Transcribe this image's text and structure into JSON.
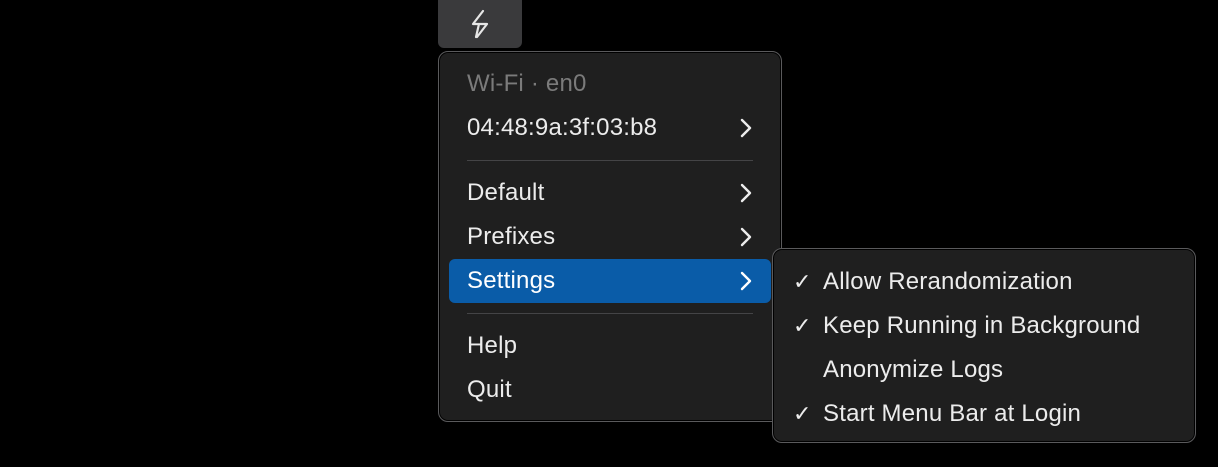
{
  "menubar": {
    "icon": "lightning-bolt-icon"
  },
  "main_menu": {
    "interface_header": "Wi-Fi · en0",
    "mac_address": "04:48:9a:3f:03:b8",
    "items": [
      {
        "label": "Default"
      },
      {
        "label": "Prefixes"
      },
      {
        "label": "Settings"
      }
    ],
    "help_label": "Help",
    "quit_label": "Quit"
  },
  "settings_menu": {
    "items": [
      {
        "label": "Allow Rerandomization",
        "checked": true,
        "mark": "✓"
      },
      {
        "label": "Keep Running in Background",
        "checked": true,
        "mark": "✓"
      },
      {
        "label": "Anonymize Logs",
        "checked": false,
        "mark": ""
      },
      {
        "label": "Start Menu Bar at Login",
        "checked": true,
        "mark": "✓"
      }
    ]
  },
  "colors": {
    "highlight": "#0a5ca8",
    "menu_background": "#1f1f1f",
    "disabled_text": "#7b7b7b"
  }
}
